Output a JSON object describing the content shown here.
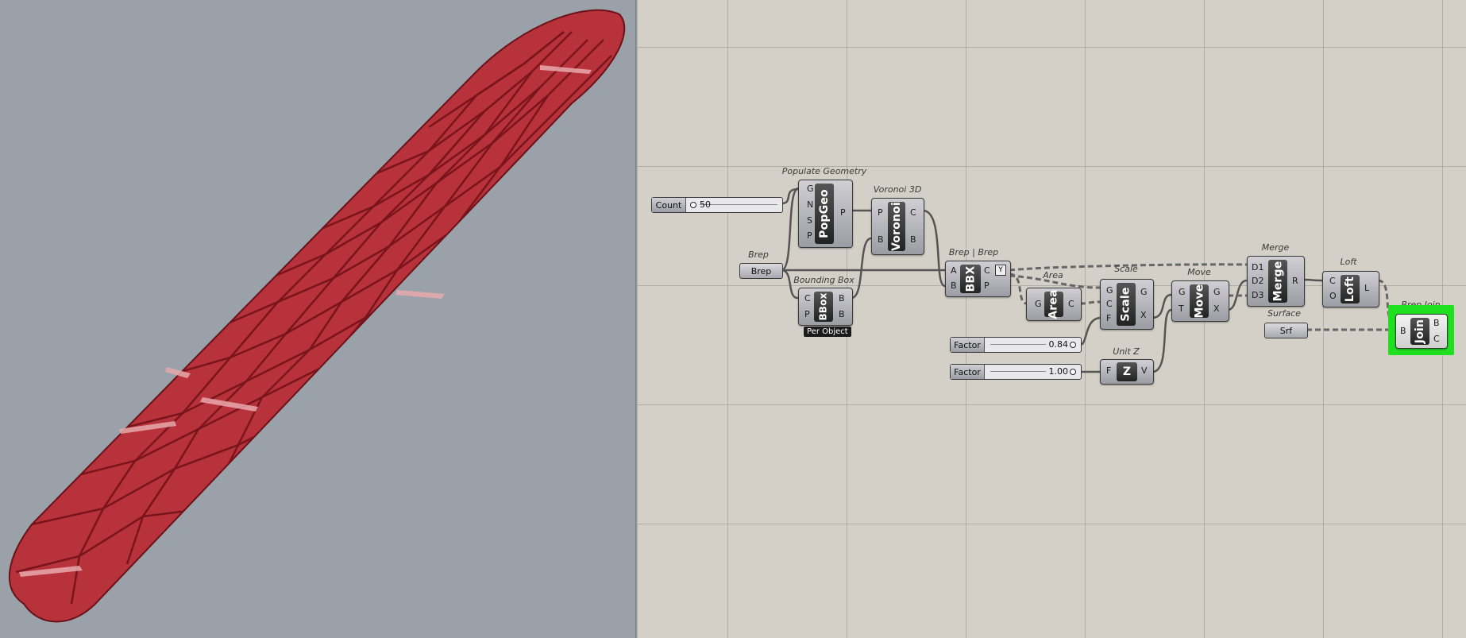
{
  "viewport": {
    "background": "#9aa1a9",
    "object_color": "#b8323b"
  },
  "canvas": {
    "count_slider": {
      "label": "Count",
      "value": "50"
    },
    "brep_param": {
      "title": "Brep",
      "label": "Brep"
    },
    "populate_geometry": {
      "title": "Populate Geometry",
      "core": "PopGeo",
      "inputs": [
        "G",
        "N",
        "S",
        "P"
      ],
      "outputs": [
        "P"
      ]
    },
    "voronoi_3d": {
      "title": "Voronoi 3D",
      "core": "Voronoi",
      "inputs": [
        "P",
        "B"
      ],
      "outputs": [
        "C",
        "B"
      ]
    },
    "bounding_box": {
      "title": "Bounding Box",
      "core": "BBox",
      "inputs": [
        "C",
        "P"
      ],
      "outputs": [
        "B",
        "B"
      ],
      "tag": "Per Object"
    },
    "brep_brep": {
      "title": "Brep | Brep",
      "core": "BBX",
      "inputs": [
        "A",
        "B"
      ],
      "outputs": [
        "C",
        "P"
      ],
      "flag": "Y"
    },
    "area": {
      "title": "Area",
      "core": "Area",
      "inputs": [
        "G"
      ],
      "outputs": [
        "C"
      ]
    },
    "scale": {
      "title": "Scale",
      "core": "Scale",
      "inputs": [
        "G",
        "C",
        "F"
      ],
      "outputs": [
        "G",
        "X"
      ]
    },
    "move": {
      "title": "Move",
      "core": "Move",
      "inputs": [
        "G",
        "T"
      ],
      "outputs": [
        "G",
        "X"
      ]
    },
    "merge": {
      "title": "Merge",
      "core": "Merge",
      "inputs": [
        "D1",
        "D2",
        "D3"
      ],
      "outputs": [
        "R"
      ]
    },
    "loft": {
      "title": "Loft",
      "core": "Loft",
      "inputs": [
        "C",
        "O"
      ],
      "outputs": [
        "L"
      ]
    },
    "surface_param": {
      "title": "Surface",
      "label": "Srf"
    },
    "brep_join": {
      "title": "Brep Join",
      "core": "Join",
      "inputs": [
        "B"
      ],
      "outputs": [
        "B",
        "C"
      ],
      "highlight": "#1fe01f"
    },
    "factor_1": {
      "label": "Factor",
      "value": "0.84"
    },
    "factor_2": {
      "label": "Factor",
      "value": "1.00"
    },
    "unit_z": {
      "title": "Unit Z",
      "core": "Z",
      "inputs": [
        "F"
      ],
      "outputs": [
        "V"
      ]
    }
  }
}
